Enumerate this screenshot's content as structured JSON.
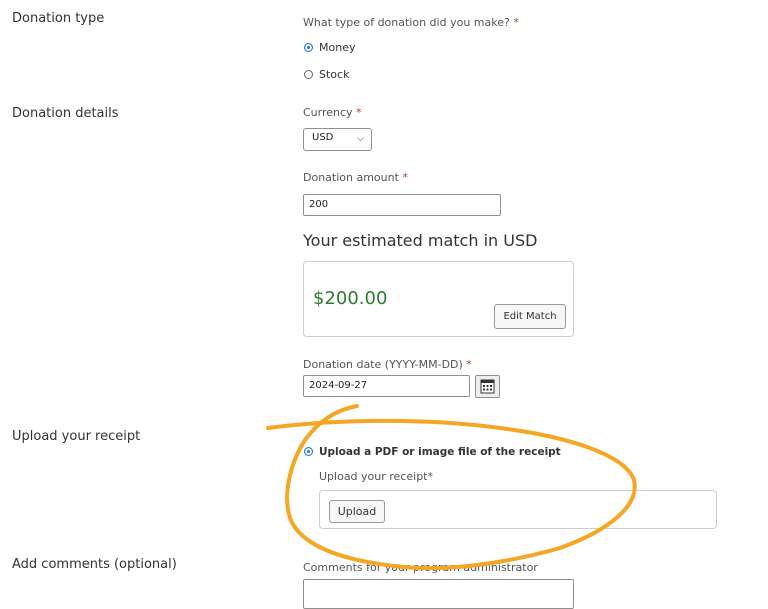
{
  "sections": {
    "donation_type": "Donation type",
    "donation_details": "Donation details",
    "upload_receipt": "Upload your receipt",
    "comments": "Add comments (optional)"
  },
  "donation_type": {
    "question": "What type of donation did you make?",
    "required_mark": "*",
    "options": [
      {
        "label": "Money",
        "checked": true
      },
      {
        "label": "Stock",
        "checked": false
      }
    ]
  },
  "currency": {
    "label": "Currency",
    "required_mark": "*",
    "value": "USD"
  },
  "amount": {
    "label": "Donation amount",
    "required_mark": "*",
    "value": "200"
  },
  "match": {
    "heading": "Your estimated match in USD",
    "amount": "$200.00",
    "edit_label": "Edit Match"
  },
  "date": {
    "label": "Donation date (YYYY-MM-DD)",
    "required_mark": "*",
    "value": "2024-09-27"
  },
  "receipt": {
    "option_label": "Upload a PDF or image file of the receipt",
    "field_label": "Upload your receipt*",
    "upload_label": "Upload"
  },
  "comments": {
    "label": "Comments for your program administrator"
  },
  "colors": {
    "accent": "#1a73e8",
    "match_green": "#2e7d32",
    "required": "#c0392b",
    "annotation": "#f5a623"
  }
}
